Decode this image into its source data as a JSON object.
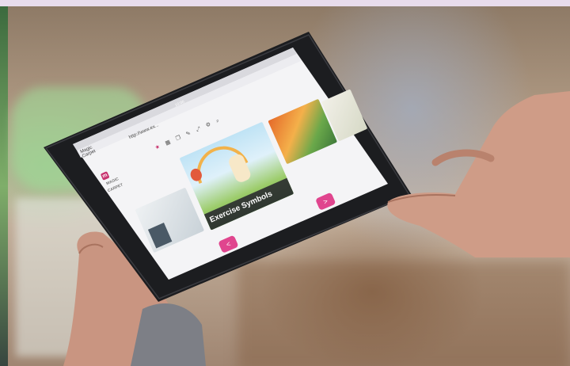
{
  "photo": {
    "subject": "",
    "colors": {
      "accent": "#e0458e",
      "brand": "#c8326e",
      "tablet_body": "#1c1d20",
      "screen": "#f4f4f6"
    }
  },
  "tablet": {
    "status_time": "10:00",
    "browser": {
      "tab_title": "Magic Carpet",
      "address": "http://www.ex..."
    },
    "app": {
      "logo_text": "MAGIC CARPET",
      "featured_card_label": "Exercise Symbols",
      "prev_button_label": "<",
      "next_button_label": ">",
      "toolbar_icons": [
        "star-icon",
        "grid-icon",
        "copy-icon",
        "pencil-icon",
        "expand-icon",
        "gear-icon",
        "search-icon"
      ]
    }
  }
}
